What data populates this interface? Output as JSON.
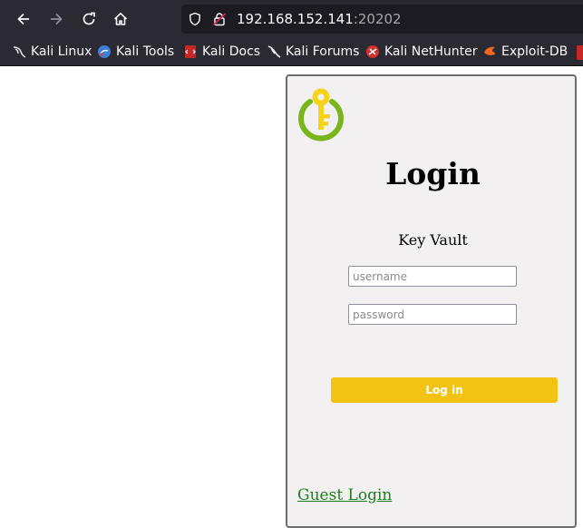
{
  "browser": {
    "url_host": "192.168.152.141",
    "url_port": ":20202",
    "bookmarks": [
      {
        "label": "Kali Linux",
        "icon": "kali-dragon-icon"
      },
      {
        "label": "Kali Tools",
        "icon": "kali-tools-icon"
      },
      {
        "label": "Kali Docs",
        "icon": "kali-docs-icon"
      },
      {
        "label": "Kali Forums",
        "icon": "kali-forums-icon"
      },
      {
        "label": "Kali NetHunter",
        "icon": "nethunter-icon"
      },
      {
        "label": "Exploit-DB",
        "icon": "exploit-db-icon"
      }
    ]
  },
  "login": {
    "title": "Login",
    "vault_name": "Key Vault",
    "username_placeholder": "username",
    "password_placeholder": "password",
    "submit_label": "Log in",
    "guest_link": "Guest Login"
  },
  "colors": {
    "chrome_bg": "#2b2a33",
    "urlbar_bg": "#1c1b22",
    "card_bg": "#f2f0f0",
    "button_bg": "#f2c312",
    "logo_green": "#79b51d",
    "logo_yellow": "#f4d319",
    "link_green": "#1d7f1d"
  }
}
